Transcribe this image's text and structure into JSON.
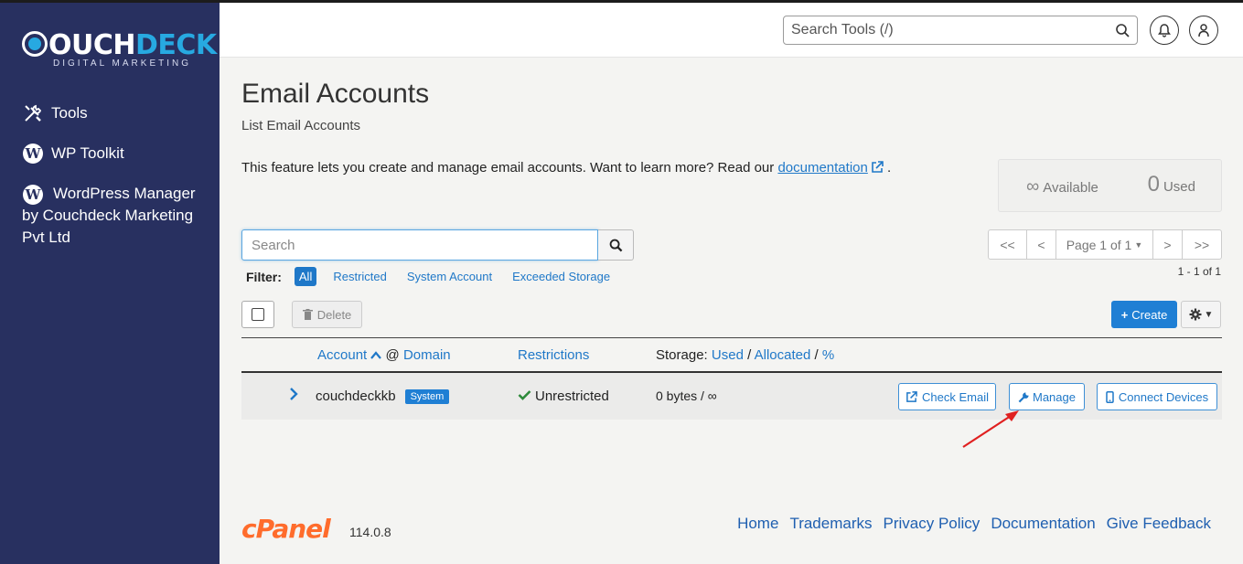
{
  "brand": {
    "name_part1": "OUCH",
    "name_part2": "DECK",
    "tagline": "DIGITAL MARKETING"
  },
  "sidebar": {
    "items": [
      {
        "label": "Tools",
        "icon": "tools-icon"
      },
      {
        "label": "WP Toolkit",
        "icon": "wordpress-icon"
      },
      {
        "label": "WordPress Manager by Couchdeck Marketing Pvt Ltd",
        "icon": "wordpress-icon"
      }
    ]
  },
  "header": {
    "search_placeholder": "Search Tools (/)"
  },
  "page": {
    "title": "Email Accounts",
    "subtitle": "List Email Accounts",
    "description": "This feature lets you create and manage email accounts. Want to learn more? Read our",
    "doc_link": "documentation",
    "description_end": "."
  },
  "stats": {
    "available_value": "∞",
    "available_label": "Available",
    "used_value": "0",
    "used_label": "Used"
  },
  "search": {
    "placeholder": "Search"
  },
  "filter": {
    "label": "Filter:",
    "options": [
      "All",
      "Restricted",
      "System Account",
      "Exceeded Storage"
    ],
    "active": "All"
  },
  "pagination": {
    "first": "<<",
    "prev": "<",
    "page_label": "Page 1 of 1",
    "next": ">",
    "last": ">>",
    "count": "1 - 1 of 1"
  },
  "toolbar": {
    "delete_label": "Delete",
    "create_label": "Create"
  },
  "table": {
    "headers": {
      "account": "Account",
      "at": "@",
      "domain": "Domain",
      "restrictions": "Restrictions",
      "storage_prefix": "Storage:",
      "used": "Used",
      "sep1": "/",
      "allocated": "Allocated",
      "sep2": "/",
      "percent": "%"
    },
    "rows": [
      {
        "account": "couchdeckkb",
        "badge": "System",
        "restriction": "Unrestricted",
        "storage": "0 bytes / ∞",
        "actions": [
          "Check Email",
          "Manage",
          "Connect Devices"
        ]
      }
    ]
  },
  "footer": {
    "logo": "cPanel",
    "version": "114.0.8",
    "links": [
      "Home",
      "Trademarks",
      "Privacy Policy",
      "Documentation",
      "Give Feedback"
    ]
  },
  "colors": {
    "sidebar": "#283060",
    "accent": "#1f7fd4",
    "link": "#1f78c8",
    "cpanel": "#ff6c2c",
    "annotation": "#e02020"
  }
}
